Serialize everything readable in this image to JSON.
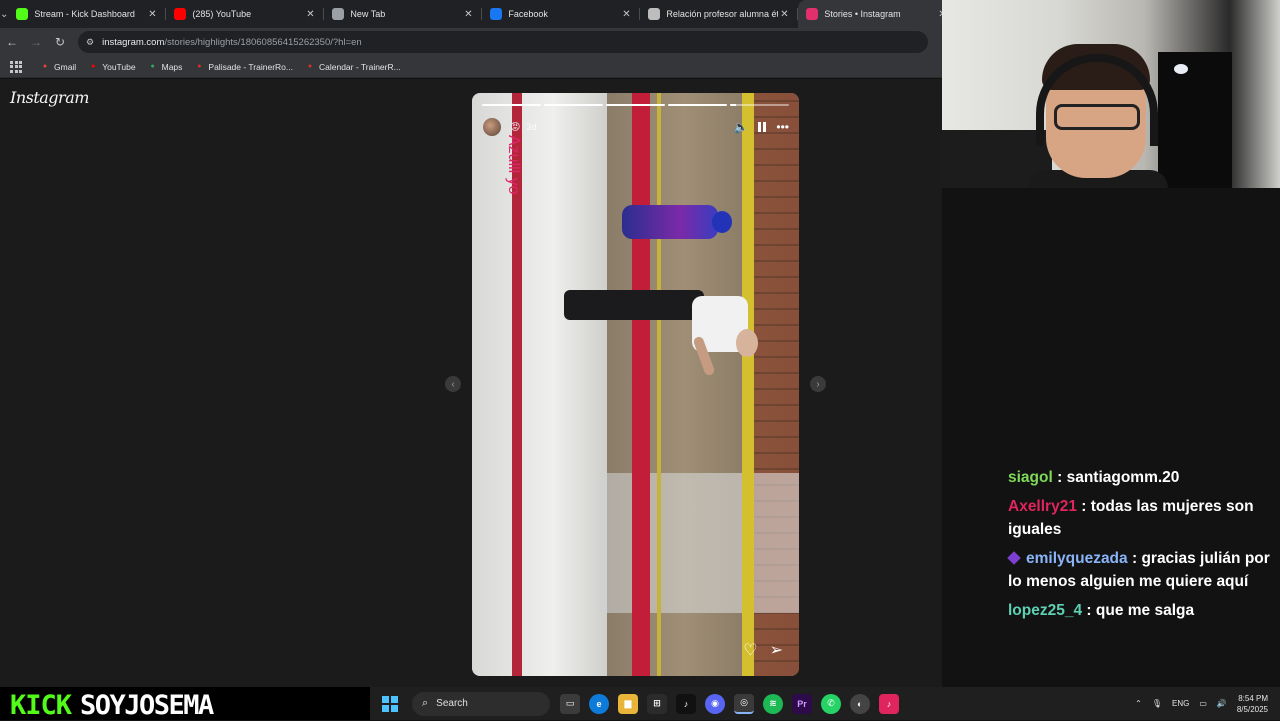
{
  "browser": {
    "tabs": [
      {
        "title": "Stream - Kick Dashboard",
        "icon": "kick-icon",
        "color": "#53fc18",
        "active": false
      },
      {
        "title": "(285) YouTube",
        "icon": "youtube-icon",
        "color": "#ff0000",
        "active": false
      },
      {
        "title": "New Tab",
        "icon": "chrome-icon",
        "color": "#9aa0a6",
        "active": false
      },
      {
        "title": "Facebook",
        "icon": "facebook-icon",
        "color": "#1877f2",
        "active": false
      },
      {
        "title": "Relación profesor alumna ética",
        "icon": "chatgpt-icon",
        "color": "#bdbdbd",
        "active": false
      },
      {
        "title": "Stories • Instagram",
        "icon": "instagram-icon",
        "color": "#e1306c",
        "active": true
      }
    ],
    "url_host": "instagram.com",
    "url_path": "/stories/highlights/18060856415262350/?hl=en",
    "bookmarks": [
      {
        "label": "Gmail",
        "icon": "gmail-icon"
      },
      {
        "label": "YouTube",
        "icon": "youtube-icon"
      },
      {
        "label": "Maps",
        "icon": "maps-icon"
      },
      {
        "label": "Palisade - TrainerRo...",
        "icon": "trainer-icon"
      },
      {
        "label": "Calendar - TrainerR...",
        "icon": "trainer-icon"
      }
    ]
  },
  "instagram": {
    "logo": "Instagram",
    "story": {
      "time": "3d",
      "caption": "Azulll yo",
      "segments": 5,
      "progress": [
        1,
        1,
        1,
        1,
        0.1
      ]
    }
  },
  "chat": [
    {
      "user": "siagol",
      "user_color": "#7ed957",
      "text": "santiagomm.20",
      "badge": false
    },
    {
      "user": "Axellry21",
      "user_color": "#e0245e",
      "text": "todas las mujeres son iguales",
      "badge": false
    },
    {
      "user": "emilyquezada",
      "user_color": "#8ab4f8",
      "text": "gracias julián por lo menos alguien me quiere aquí",
      "badge": true
    },
    {
      "user": "lopez25_4",
      "user_color": "#5ed0b3",
      "text": "que me salga",
      "badge": false
    }
  ],
  "overlay": {
    "kick_logo": "KICK",
    "channel": "SOYJOSEMA"
  },
  "taskbar": {
    "search_label": "Search",
    "language": "ENG",
    "time": "8:54 PM",
    "date": "8/5/2025"
  }
}
